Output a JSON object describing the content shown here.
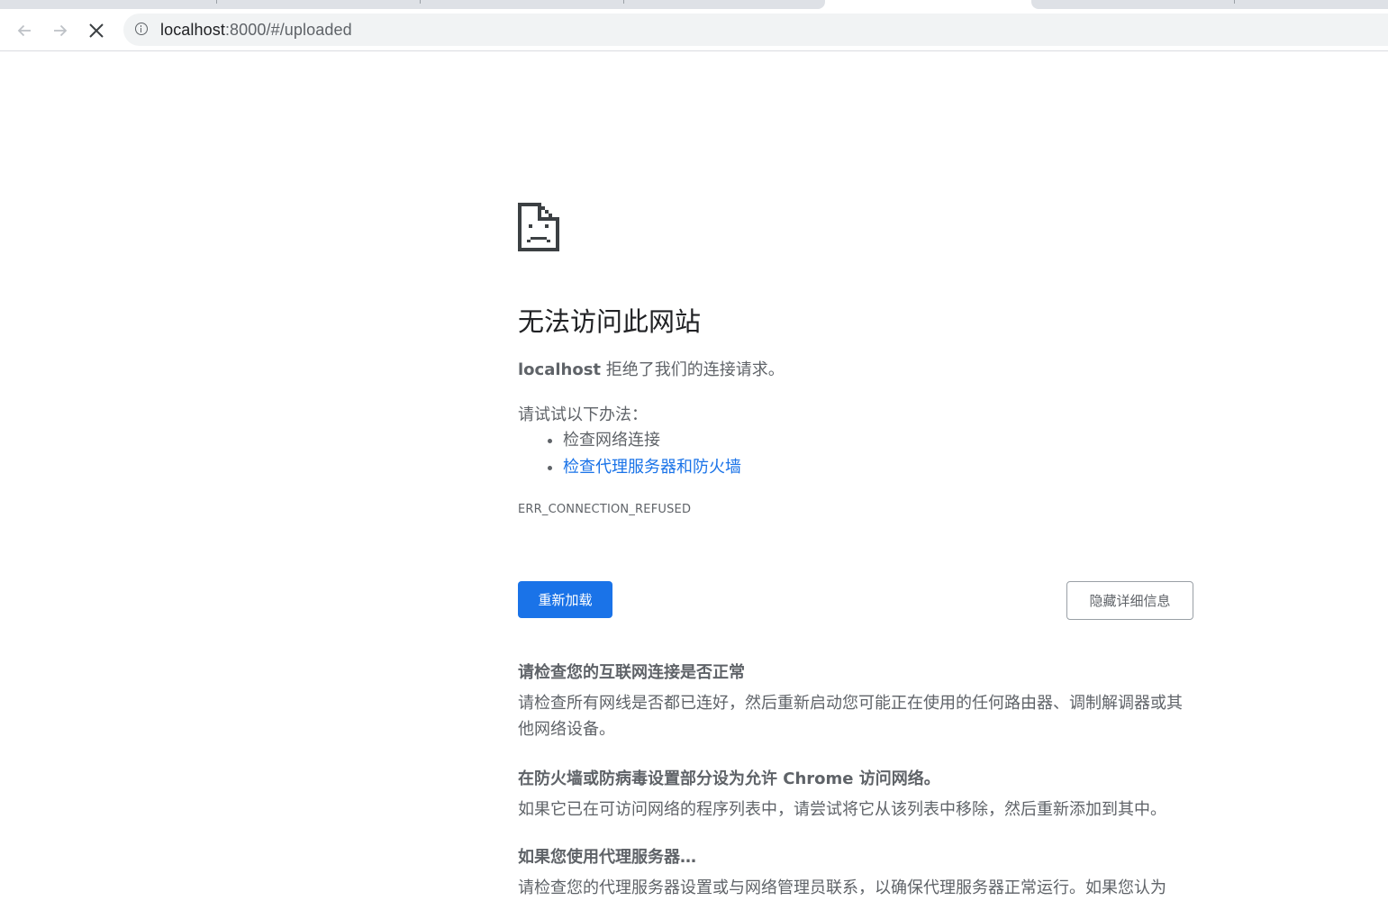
{
  "browser": {
    "url_host": "localhost",
    "url_rest": ":8000/#/uploaded"
  },
  "error": {
    "heading": "无法访问此网站",
    "summary_host": "localhost",
    "summary_text": " 拒绝了我们的连接请求。",
    "suggestions_title": "请试试以下办法：",
    "suggestions": [
      "检查网络连接",
      "检查代理服务器和防火墙"
    ],
    "code": "ERR_CONNECTION_REFUSED",
    "reload_label": "重新加载",
    "details_label": "隐藏详细信息",
    "details": [
      {
        "title": "请检查您的互联网连接是否正常",
        "text": "请检查所有网线是否都已连好，然后重新启动您可能正在使用的任何路由器、调制解调器或其他网络设备。"
      },
      {
        "title": "在防火墙或防病毒设置部分设为允许 Chrome 访问网络。",
        "text": "如果它已在可访问网络的程序列表中，请尝试将它从该列表中移除，然后重新添加到其中。"
      },
      {
        "title": "如果您使用代理服务器…",
        "text": "请检查您的代理服务器设置或与网络管理员联系，以确保代理服务器正常运行。如果您认为"
      }
    ]
  },
  "colors": {
    "primary": "#1a73e8",
    "text_secondary": "#5f6368",
    "omnibox_bg": "#f1f3f4"
  }
}
